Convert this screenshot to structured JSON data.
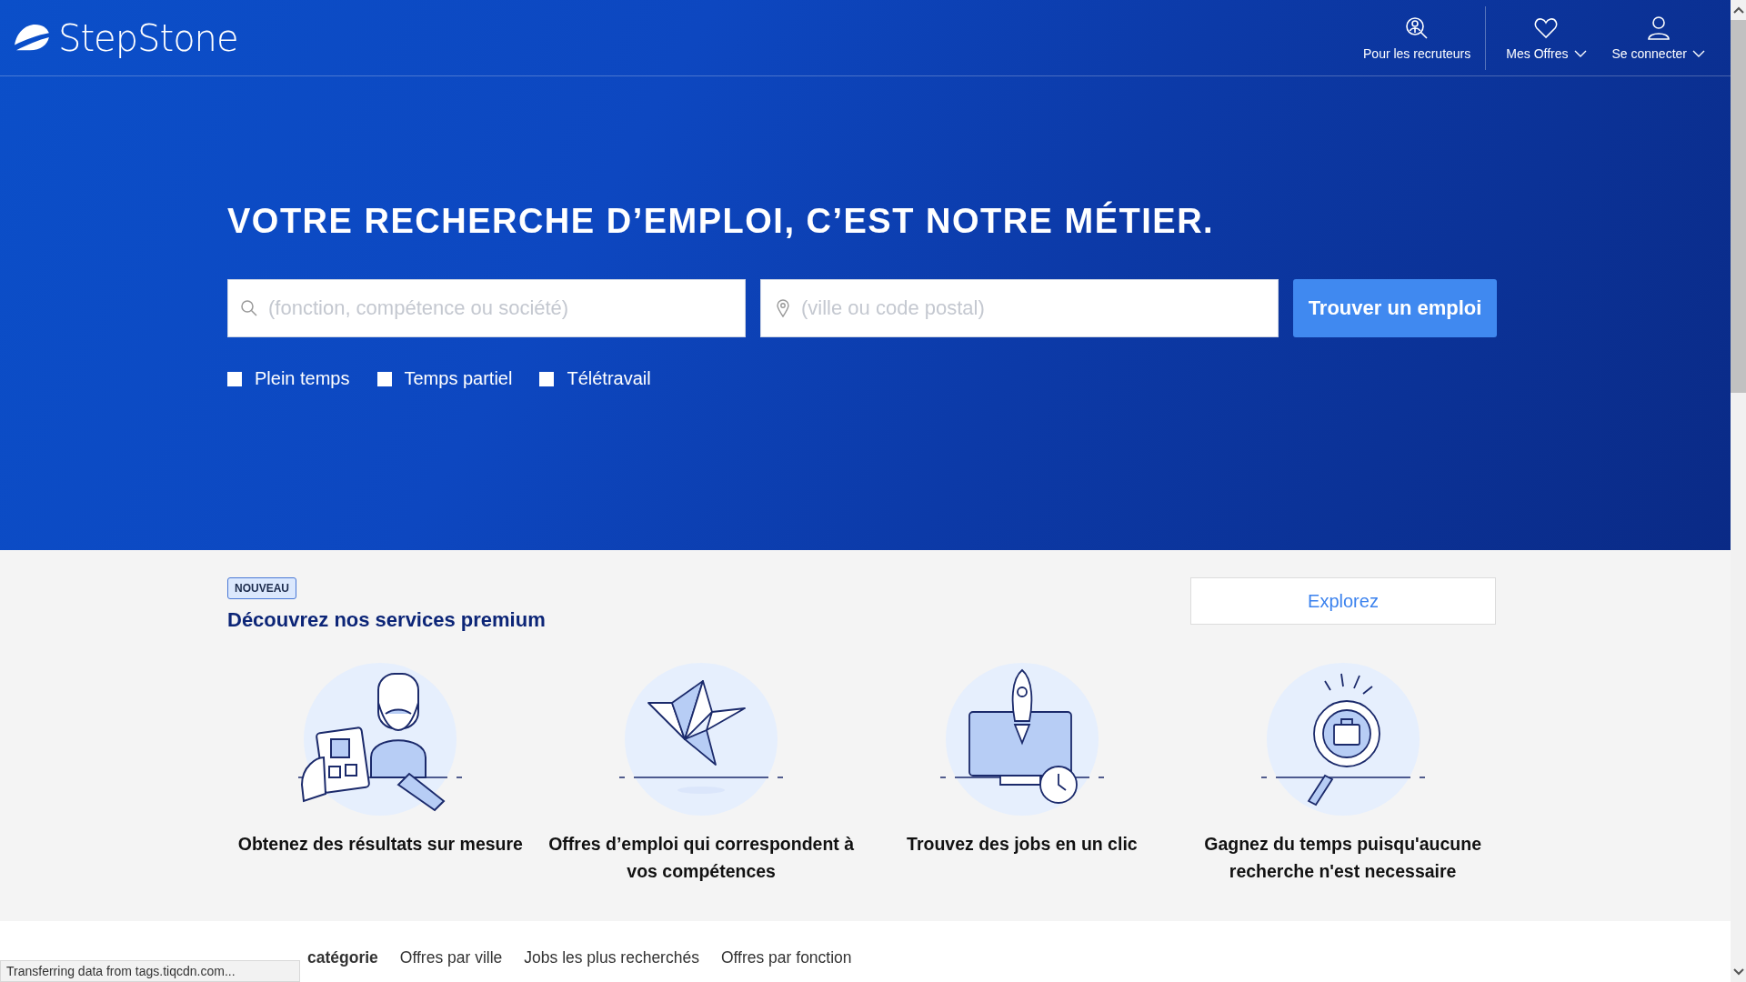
{
  "header": {
    "logo": "StepStone",
    "nav": [
      {
        "kind": "recruiter",
        "label": "Pour les recruteurs",
        "dropdown": false
      },
      {
        "kind": "heart",
        "label": "Mes Offres",
        "dropdown": true
      },
      {
        "kind": "user",
        "label": "Se connecter",
        "dropdown": true
      }
    ]
  },
  "hero": {
    "title": "VOTRE RECHERCHE D’EMPLOI, C’EST NOTRE MÉTIER.",
    "what": {
      "placeholder": "(fonction, compétence ou société)"
    },
    "where": {
      "placeholder": "(ville ou code postal)"
    },
    "button": "Trouver un emploi",
    "filters": [
      {
        "label": "Plein temps",
        "checked": false
      },
      {
        "label": "Temps partiel",
        "checked": false
      },
      {
        "label": "Télétravail",
        "checked": false
      }
    ]
  },
  "premium": {
    "badge": "NOUVEAU",
    "title": "Découvrez nos services premium",
    "button": "Explorez",
    "features": [
      {
        "kind": "person",
        "text": "Obtenez des résultats sur mesure"
      },
      {
        "kind": "bird",
        "text": "Offres d’emploi qui correspondent à vos compétences"
      },
      {
        "kind": "rocket",
        "text": "Trouvez des jobs en un clic"
      },
      {
        "kind": "magnifier",
        "text": "Gagnez du temps puisqu'aucune recherche n'est necessaire"
      }
    ]
  },
  "tabs": [
    {
      "label": "catégorie",
      "selected": true
    },
    {
      "label": "Offres par ville",
      "selected": false
    },
    {
      "label": "Jobs les plus recherchés",
      "selected": false
    },
    {
      "label": "Offres par fonction",
      "selected": false
    }
  ],
  "status_bar": "Transferring data from tags.tiqcdn.com..."
}
